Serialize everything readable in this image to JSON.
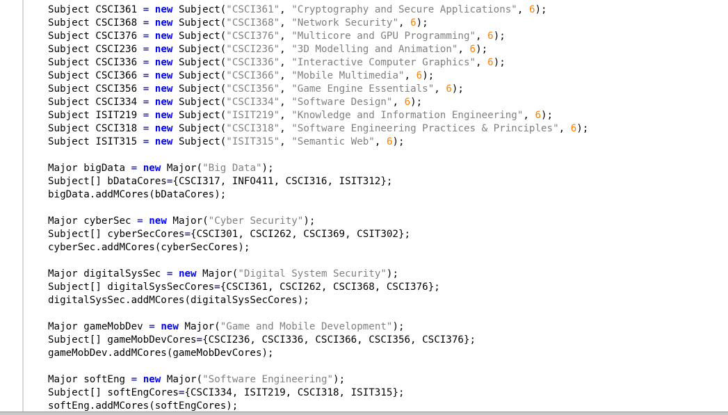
{
  "editor": {
    "keywords": {
      "new": "new"
    },
    "subjects": [
      {
        "id": "CSCI361",
        "code": "CSCI361",
        "title": "Cryptography and Secure Applications",
        "points": "6"
      },
      {
        "id": "CSCI368",
        "code": "CSCI368",
        "title": "Network Security",
        "points": "6"
      },
      {
        "id": "CSCI376",
        "code": "CSCI376",
        "title": "Multicore and GPU Programming",
        "points": "6"
      },
      {
        "id": "CSCI236",
        "code": "CSCI236",
        "title": "3D Modelling and Animation",
        "points": "6"
      },
      {
        "id": "CSCI336",
        "code": "CSCI336",
        "title": "Interactive Computer Graphics",
        "points": "6"
      },
      {
        "id": "CSCI366",
        "code": "CSCI366",
        "title": "Mobile Multimedia",
        "points": "6"
      },
      {
        "id": "CSCI356",
        "code": "CSCI356",
        "title": "Game Engine Essentials",
        "points": "6"
      },
      {
        "id": "CSCI334",
        "code": "CSCI334",
        "title": "Software Design",
        "points": "6"
      },
      {
        "id": "ISIT219",
        "code": "ISIT219",
        "title": "Knowledge and Information Engineering",
        "points": "6"
      },
      {
        "id": "CSCI318",
        "code": "CSCI318",
        "title": "Software Engineering Practices & Principles",
        "points": "6"
      },
      {
        "id": "ISIT315",
        "code": "ISIT315",
        "title": "Semantic Web",
        "points": "6"
      }
    ],
    "majors": [
      {
        "var": "bigData",
        "name": "Big Data",
        "cores_var": "bDataCores",
        "cores": "CSCI317, INFO411, CSCI316, ISIT312"
      },
      {
        "var": "cyberSec",
        "name": "Cyber Security",
        "cores_var": "cyberSecCores",
        "cores": "CSCI301, CSCI262, CSCI369, CSIT302"
      },
      {
        "var": "digitalSysSec",
        "name": "Digital System Security",
        "cores_var": "digitalSysSecCores",
        "cores": "CSCI361, CSCI262, CSCI368, CSCI376"
      },
      {
        "var": "gameMobDev",
        "name": "Game and Mobile Development",
        "cores_var": "gameMobDevCores",
        "cores": "CSCI236, CSCI336, CSCI366, CSCI356, CSCI376"
      },
      {
        "var": "softEng",
        "name": "Software Engineering",
        "cores_var": "softEngCores",
        "cores": "CSCI334, ISIT219, CSCI318, ISIT315"
      }
    ]
  }
}
